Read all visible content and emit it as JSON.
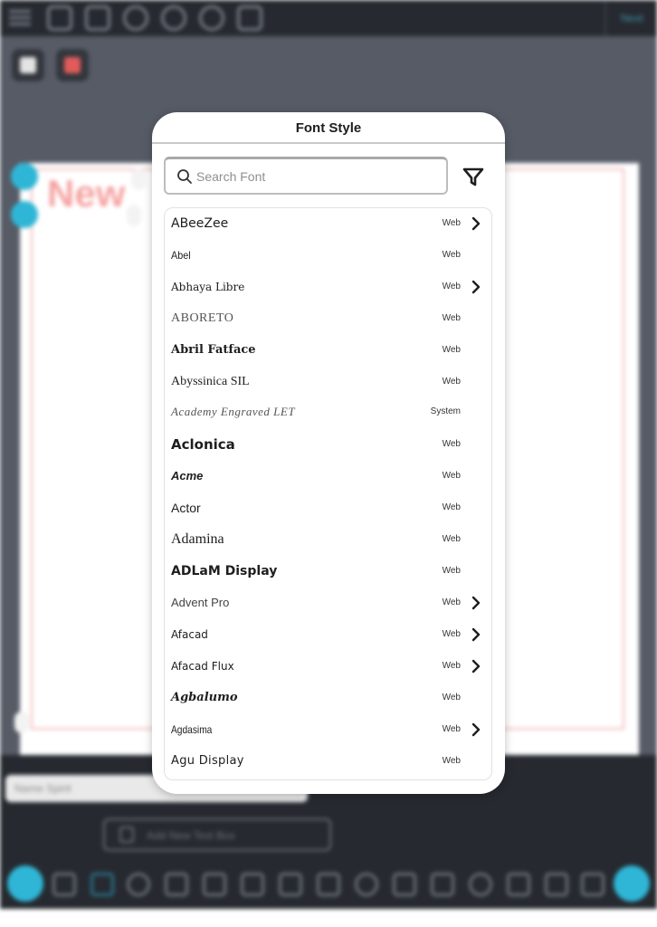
{
  "background": {
    "top_right_label": "Next",
    "canvas_text": "New",
    "name_input_value": "Name Spirit",
    "add_text_label": "Add New Text Box",
    "accent_color": "#2fb6d6"
  },
  "modal": {
    "title": "Font Style",
    "search": {
      "placeholder": "Search Font",
      "value": ""
    },
    "filter_icon": "filter-icon",
    "fonts": [
      {
        "name": "ABeeZee",
        "source": "Web",
        "has_variants": true
      },
      {
        "name": "Abel",
        "source": "Web",
        "has_variants": false
      },
      {
        "name": "Abhaya Libre",
        "source": "Web",
        "has_variants": true
      },
      {
        "name": "ABORETO",
        "source": "Web",
        "has_variants": false
      },
      {
        "name": "Abril Fatface",
        "source": "Web",
        "has_variants": false
      },
      {
        "name": "Abyssinica SIL",
        "source": "Web",
        "has_variants": false
      },
      {
        "name": "Academy Engraved LET",
        "source": "System",
        "has_variants": false
      },
      {
        "name": "Aclonica",
        "source": "Web",
        "has_variants": false
      },
      {
        "name": "Acme",
        "source": "Web",
        "has_variants": false
      },
      {
        "name": "Actor",
        "source": "Web",
        "has_variants": false
      },
      {
        "name": "Adamina",
        "source": "Web",
        "has_variants": false
      },
      {
        "name": "ADLaM Display",
        "source": "Web",
        "has_variants": false
      },
      {
        "name": "Advent Pro",
        "source": "Web",
        "has_variants": true
      },
      {
        "name": "Afacad",
        "source": "Web",
        "has_variants": true
      },
      {
        "name": "Afacad Flux",
        "source": "Web",
        "has_variants": true
      },
      {
        "name": "Agbalumo",
        "source": "Web",
        "has_variants": false
      },
      {
        "name": "Agdasima",
        "source": "Web",
        "has_variants": true
      },
      {
        "name": "Agu Display",
        "source": "Web",
        "has_variants": false
      }
    ]
  }
}
